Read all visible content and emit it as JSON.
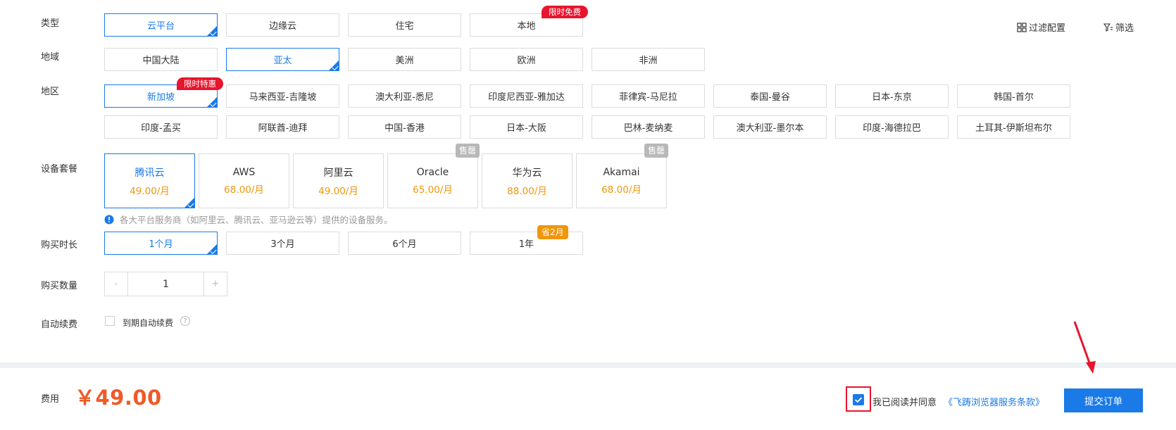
{
  "toolbar": {
    "filter_config_label": "过滤配置",
    "filter_label": "筛选"
  },
  "type": {
    "label": "类型",
    "options": [
      "云平台",
      "边缘云",
      "住宅",
      "本地"
    ],
    "badge": "限时免费"
  },
  "geo": {
    "label": "地域",
    "options": [
      "中国大陆",
      "亚太",
      "美洲",
      "欧洲",
      "非洲"
    ]
  },
  "region": {
    "label": "地区",
    "options": [
      "新加坡",
      "马来西亚-吉隆坡",
      "澳大利亚-悉尼",
      "印度尼西亚-雅加达",
      "菲律宾-马尼拉",
      "泰国-曼谷",
      "日本-东京",
      "韩国-首尔",
      "印度-孟买",
      "阿联酋-迪拜",
      "中国-香港",
      "日本-大阪",
      "巴林-麦纳麦",
      "澳大利亚-墨尔本",
      "印度-海德拉巴",
      "土耳其-伊斯坦布尔"
    ],
    "badge": "限时特惠"
  },
  "package": {
    "label": "设备套餐",
    "items": [
      {
        "name": "腾讯云",
        "price": "49.00/月"
      },
      {
        "name": "AWS",
        "price": "68.00/月"
      },
      {
        "name": "阿里云",
        "price": "49.00/月"
      },
      {
        "name": "Oracle",
        "price": "65.00/月",
        "badge": "售罄"
      },
      {
        "name": "华为云",
        "price": "88.00/月"
      },
      {
        "name": "Akamai",
        "price": "68.00/月",
        "badge": "售罄"
      }
    ],
    "notice": "各大平台服务商（如阿里云、腾讯云、亚马逊云等）提供的设备服务。"
  },
  "duration": {
    "label": "购买时长",
    "options": [
      "1个月",
      "3个月",
      "6个月",
      "1年"
    ],
    "badge": "省2月"
  },
  "quantity": {
    "label": "购买数量",
    "minus": "-",
    "value": "1",
    "plus": "+"
  },
  "auto_renew": {
    "label": "自动续费",
    "checkbox_label": "到期自动续费",
    "help": "?"
  },
  "footer": {
    "fee_label": "费用",
    "fee_value": "￥49.00",
    "agree_text": "我已阅读并同意",
    "terms_link": "《飞踌浏览器服务条款》",
    "submit_label": "提交订单"
  },
  "colors": {
    "accent": "#1a7ae8",
    "price": "#f05a28",
    "tag_red": "#e8152e",
    "tag_orange": "#f0960a",
    "annotation": "#e8152e"
  }
}
